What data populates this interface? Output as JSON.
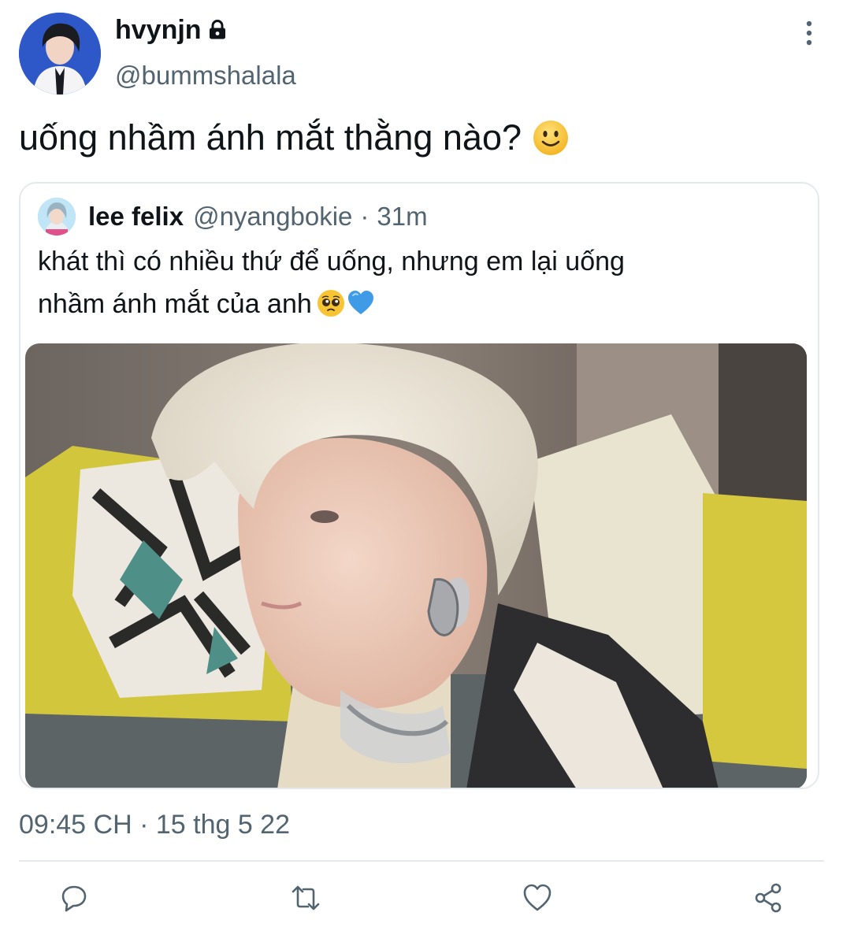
{
  "author": {
    "display_name": "hvynjn",
    "handle": "@bummshalala",
    "avatar_icon": "profile-photo-icon",
    "protected_icon": "lock-icon"
  },
  "tweet": {
    "text": "uống nhầm ánh mắt thằng nào?",
    "emoji": "slightly-smiling-face-icon",
    "timestamp": "09:45 CH · 15 thg 5 22"
  },
  "quoted_tweet": {
    "display_name": "lee felix",
    "handle": "@nyangbokie",
    "separator": "·",
    "time": "31m",
    "text_line_1": "khát thì có nhiều thứ để uống, nhưng em lại uống",
    "text_line_2": "nhầm ánh mắt của anh",
    "emojis": [
      "pleading-face-icon",
      "blue-heart-icon"
    ],
    "media_icon": "photo-icon"
  },
  "actions": [
    {
      "name": "reply",
      "icon": "reply-icon"
    },
    {
      "name": "retweet",
      "icon": "retweet-icon"
    },
    {
      "name": "like",
      "icon": "heart-icon"
    },
    {
      "name": "share",
      "icon": "share-icon"
    }
  ],
  "colors": {
    "text": "#0f1419",
    "secondary": "#536471",
    "border": "#e5e9ed",
    "background": "#ffffff"
  }
}
